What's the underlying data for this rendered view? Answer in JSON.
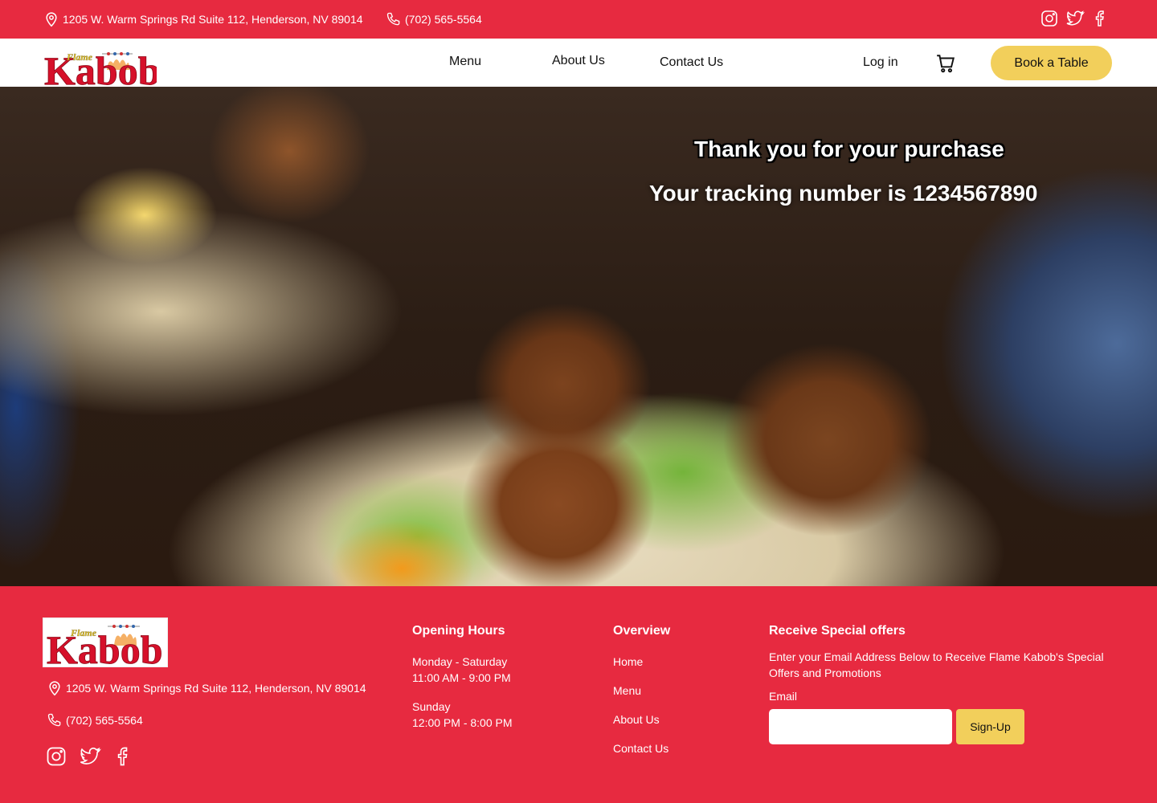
{
  "topbar": {
    "address": "1205 W. Warm Springs Rd Suite 112, Henderson, NV 89014",
    "phone": "(702) 565-5564",
    "socials": [
      "instagram-icon",
      "twitter-icon",
      "facebook-icon"
    ]
  },
  "brand": {
    "logo_small": "Flame",
    "logo_big": "Kabob",
    "primary_color": "#e72a40",
    "accent_color": "#f2cf5b"
  },
  "nav": {
    "links": [
      "Menu",
      "About Us",
      "Contact Us"
    ],
    "login": "Log in",
    "cart_icon": "cart-icon",
    "book_label": "Book a Table"
  },
  "hero": {
    "thanks": "Thank you for your purchase",
    "tracking": "Your tracking number is 1234567890"
  },
  "footer": {
    "address": "1205 W. Warm Springs Rd Suite 112, Henderson, NV 89014",
    "phone": "(702) 565-5564",
    "hours": {
      "title": "Opening Hours",
      "entries": [
        {
          "days": "Monday - Saturday",
          "time": "11:00 AM - 9:00 PM"
        },
        {
          "days": "Sunday",
          "time": "12:00 PM - 8:00 PM"
        }
      ]
    },
    "overview": {
      "title": "Overview",
      "links": [
        "Home",
        "Menu",
        "About Us",
        "Contact Us"
      ]
    },
    "offers": {
      "title": "Receive Special offers",
      "description": "Enter your Email Address Below to Receive Flame Kabob's Special Offers and Promotions",
      "email_label": "Email",
      "email_value": "",
      "email_placeholder": "",
      "signup_label": "Sign-Up"
    }
  }
}
